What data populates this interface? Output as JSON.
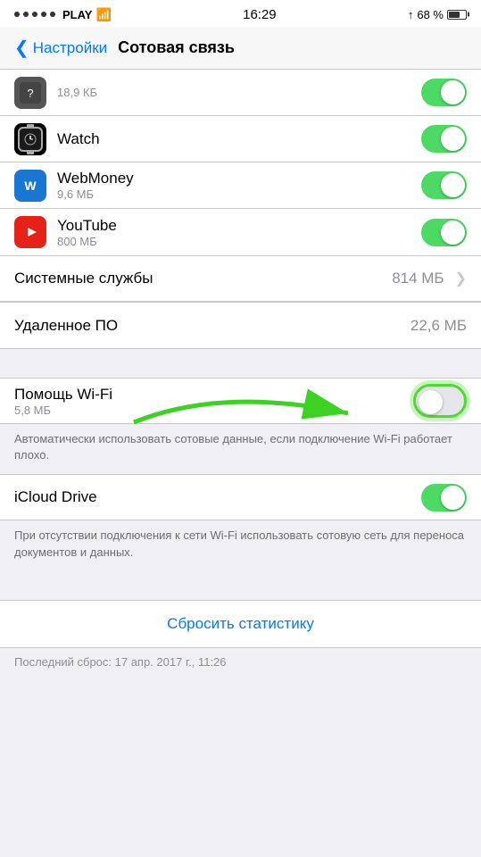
{
  "statusBar": {
    "carrier": "PLAY",
    "time": "16:29",
    "batteryPercent": "68 %"
  },
  "navBar": {
    "backLabel": "Настройки",
    "title": "Сотовая связь"
  },
  "items": [
    {
      "id": "top-item",
      "appName": "",
      "subtitle": "18,9 КБ",
      "hasIcon": false,
      "toggle": "on"
    },
    {
      "id": "watch",
      "appName": "Watch",
      "subtitle": "",
      "hasIcon": true,
      "iconType": "watch",
      "toggle": "on"
    },
    {
      "id": "webmoney",
      "appName": "WebMoney",
      "subtitle": "9,6 МБ",
      "hasIcon": true,
      "iconType": "webmoney",
      "toggle": "on"
    },
    {
      "id": "youtube",
      "appName": "YouTube",
      "subtitle": "800 МБ",
      "hasIcon": true,
      "iconType": "youtube",
      "toggle": "on"
    }
  ],
  "systemServices": {
    "label": "Системные службы",
    "value": "814 МБ"
  },
  "remoteManagement": {
    "label": "Удаленное ПО",
    "value": "22,6 МБ"
  },
  "wifiAssist": {
    "label": "Помощь Wi-Fi",
    "subtitle": "5,8 МБ",
    "toggle": "off",
    "description": "Автоматически использовать сотовые данные, если подключение Wi-Fi работает плохо."
  },
  "icloudDrive": {
    "label": "iCloud Drive",
    "toggle": "on",
    "description": "При отсутствии подключения к сети Wi-Fi использовать сотовую сеть для переноса документов и данных."
  },
  "resetStats": {
    "label": "Сбросить статистику"
  },
  "lastReset": {
    "label": "Последний сброс: 17 апр. 2017 г., 11:26"
  }
}
